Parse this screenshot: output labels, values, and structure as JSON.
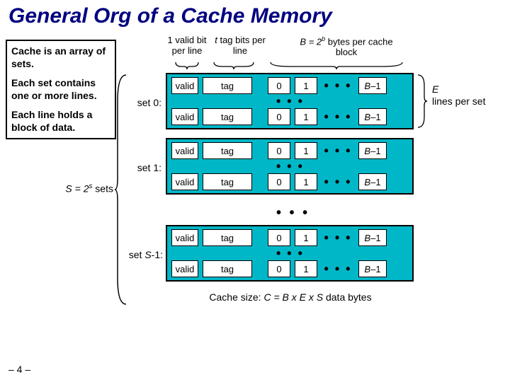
{
  "title": "General Org of a Cache Memory",
  "desc": {
    "p1": "Cache is an array of sets.",
    "p2": "Each set contains one or more lines.",
    "p3": "Each line holds a block of data."
  },
  "header": {
    "valid": "1 valid bit per line",
    "tag_it": "t",
    "tag_rest": " tag bits per line",
    "block_it": "B = 2",
    "block_sup": "b",
    "block_rest": " bytes per cache block"
  },
  "slabel": {
    "it": "S = 2",
    "sup": "s",
    "rest": " sets"
  },
  "lines_note": {
    "it": "E",
    "rest": " lines per set"
  },
  "set_labels": {
    "s0": "set 0:",
    "s1": "set 1:",
    "slast_pre": "set ",
    "slast_it": "S",
    "slast_post": "-1:"
  },
  "cells": {
    "valid": "valid",
    "tag": "tag",
    "b0": "0",
    "b1": "1",
    "dots": "• • •",
    "blast_pre": "B",
    "blast_post": "–1"
  },
  "vdots": "• • •",
  "footer": {
    "pre": "Cache size:  ",
    "it": "C = B x E x S",
    "post": " data bytes"
  },
  "pagenum": "– 4 –",
  "chart_data": {
    "type": "table",
    "title": "General Org of a Cache Memory",
    "structure": {
      "sets": "S = 2^s",
      "lines_per_set": "E",
      "valid_bits_per_line": 1,
      "tag_bits_per_line": "t",
      "bytes_per_block": "B = 2^b",
      "cache_size": "C = B × E × S data bytes"
    },
    "line_fields": [
      "valid",
      "tag",
      "byte[0]",
      "byte[1]",
      "…",
      "byte[B-1]"
    ],
    "sets_shown": [
      "set 0",
      "set 1",
      "…",
      "set S-1"
    ]
  }
}
